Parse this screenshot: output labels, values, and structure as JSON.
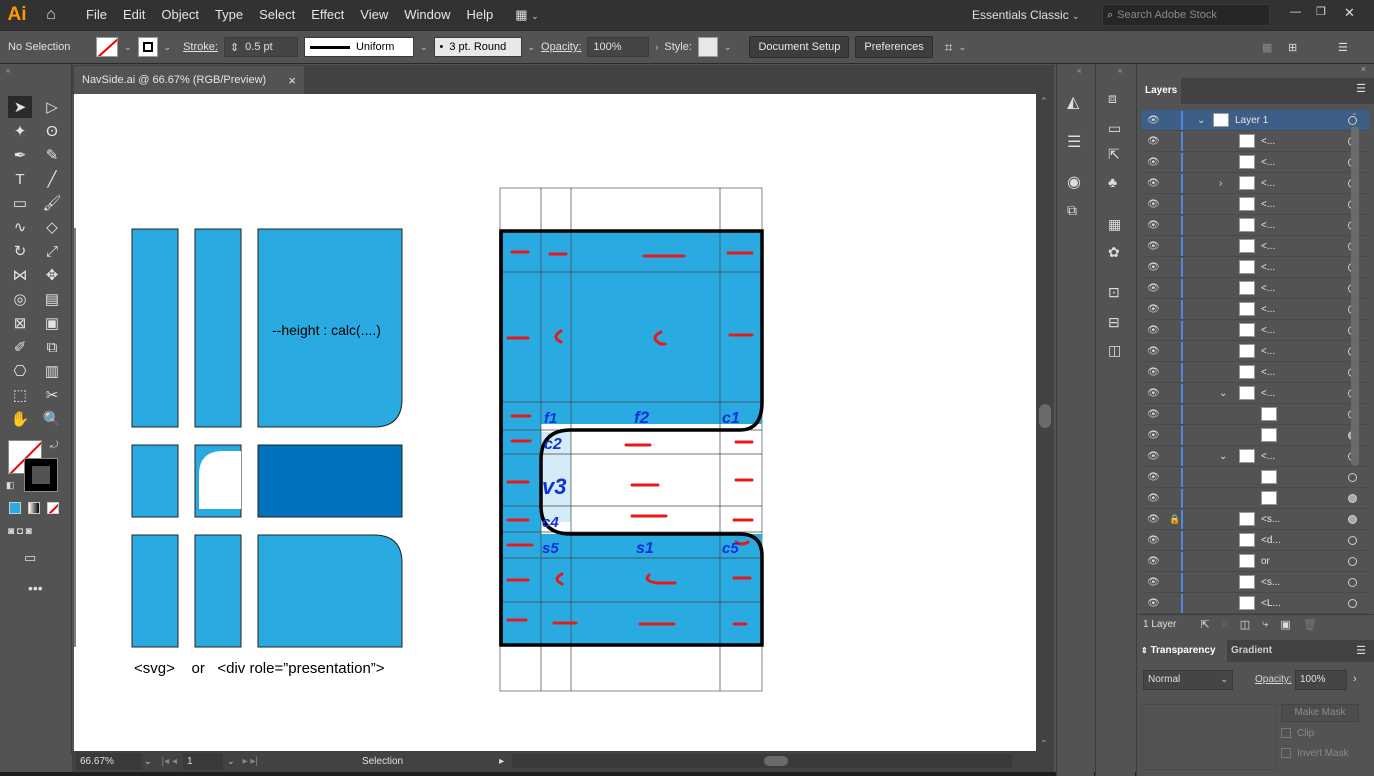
{
  "app": {
    "logo": "Ai",
    "workspace": "Essentials Classic",
    "search_placeholder": "Search Adobe Stock"
  },
  "menu": [
    "File",
    "Edit",
    "Object",
    "Type",
    "Select",
    "Effect",
    "View",
    "Window",
    "Help"
  ],
  "control": {
    "selection": "No Selection",
    "stroke_label": "Stroke:",
    "stroke_value": "0.5 pt",
    "profile": "Uniform",
    "brush": "3 pt. Round",
    "opacity_label": "Opacity:",
    "opacity_value": "100%",
    "style_label": "Style:",
    "doc_setup": "Document Setup",
    "preferences": "Preferences"
  },
  "document": {
    "tab_title": "NavSide.ai @ 66.67% (RGB/Preview)",
    "close": "×"
  },
  "artwork": {
    "height_text": "--height : calc(....)",
    "caption": "<svg>    or   <div role=”presentation”>",
    "annotations": {
      "f1": "f1",
      "f2": "f2",
      "c1": "c1",
      "c2": "c2",
      "v3": "v3",
      "c4": "c4",
      "s5": "s5",
      "s1": "s1",
      "cs": "c5"
    }
  },
  "status": {
    "zoom": "66.67%",
    "page": "1",
    "mode": "Selection"
  },
  "layers": {
    "tab": "Layers",
    "layer1": "Layer 1",
    "rows": [
      "<...",
      "<...",
      "<...",
      "<...",
      "<...",
      "<...",
      "<...",
      "<...",
      "<...",
      "<...",
      "<...",
      "<...",
      "<...",
      "",
      "",
      "<...",
      "",
      "",
      "<s...",
      "<d...",
      "or",
      "<s...",
      "<L..."
    ],
    "count": "1 Layer"
  },
  "transparency": {
    "tab": "Transparency",
    "tab2": "Gradient",
    "blend": "Normal",
    "opacity_label": "Opacity:",
    "opacity_value": "100%",
    "make_mask": "Make Mask",
    "clip": "Clip",
    "invert": "Invert Mask"
  },
  "colors": {
    "blue": "#29abe2",
    "dark_blue": "#0071bc",
    "accent": "#ff9a00"
  }
}
